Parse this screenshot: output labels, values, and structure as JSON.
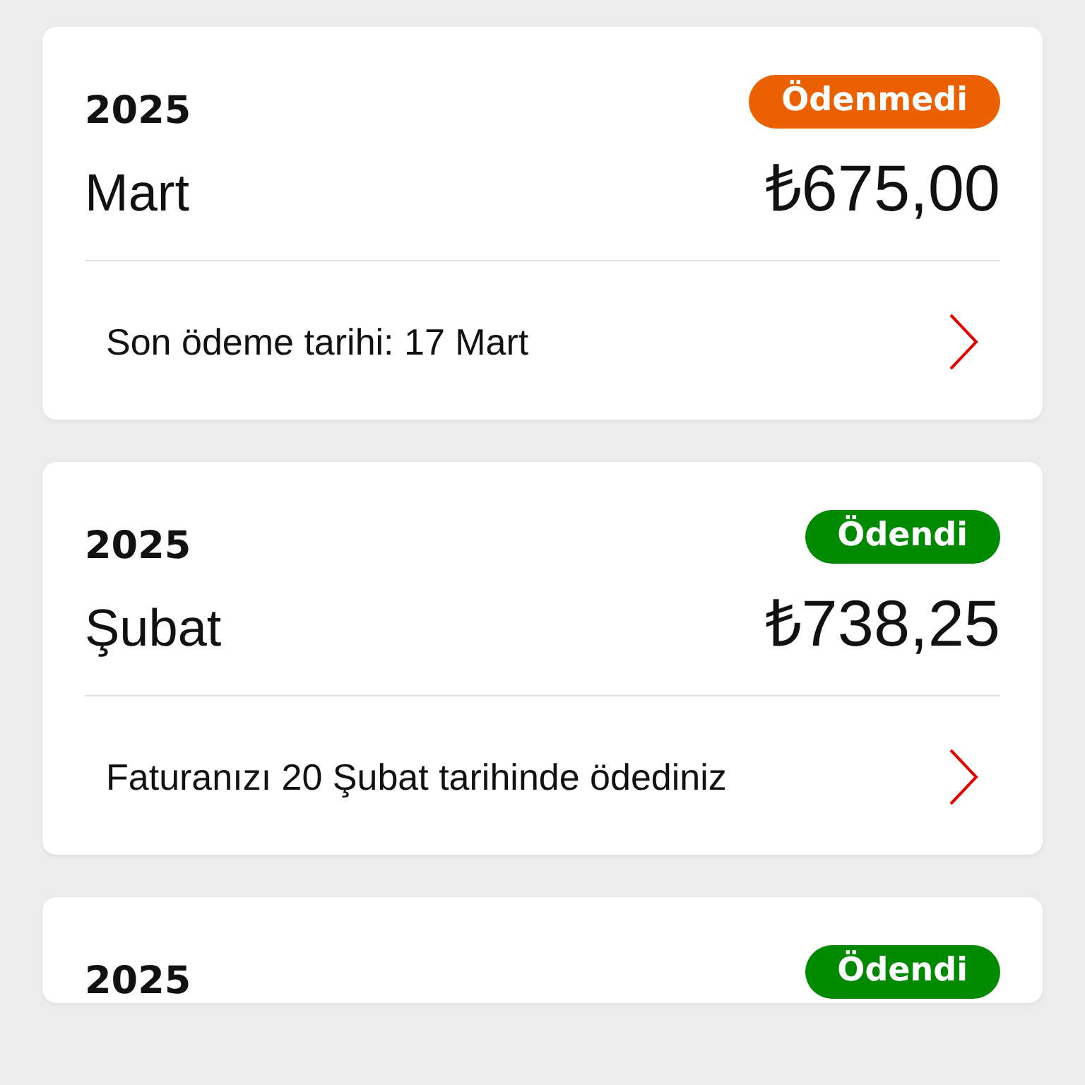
{
  "bills": [
    {
      "year": "2025",
      "status": "Ödenmedi",
      "color": "#eb6100",
      "month": "Mart",
      "amount": "₺675,00",
      "note": "Son ödeme tarihi: 17 Mart"
    },
    {
      "year": "2025",
      "status": "Ödendi",
      "color": "#008a00",
      "month": "Şubat",
      "amount": "₺738,25",
      "note": "Faturanızı 20 Şubat tarihinde ödediniz"
    },
    {
      "year": "2025",
      "status": "Ödendi",
      "color": "#008a00"
    }
  ]
}
